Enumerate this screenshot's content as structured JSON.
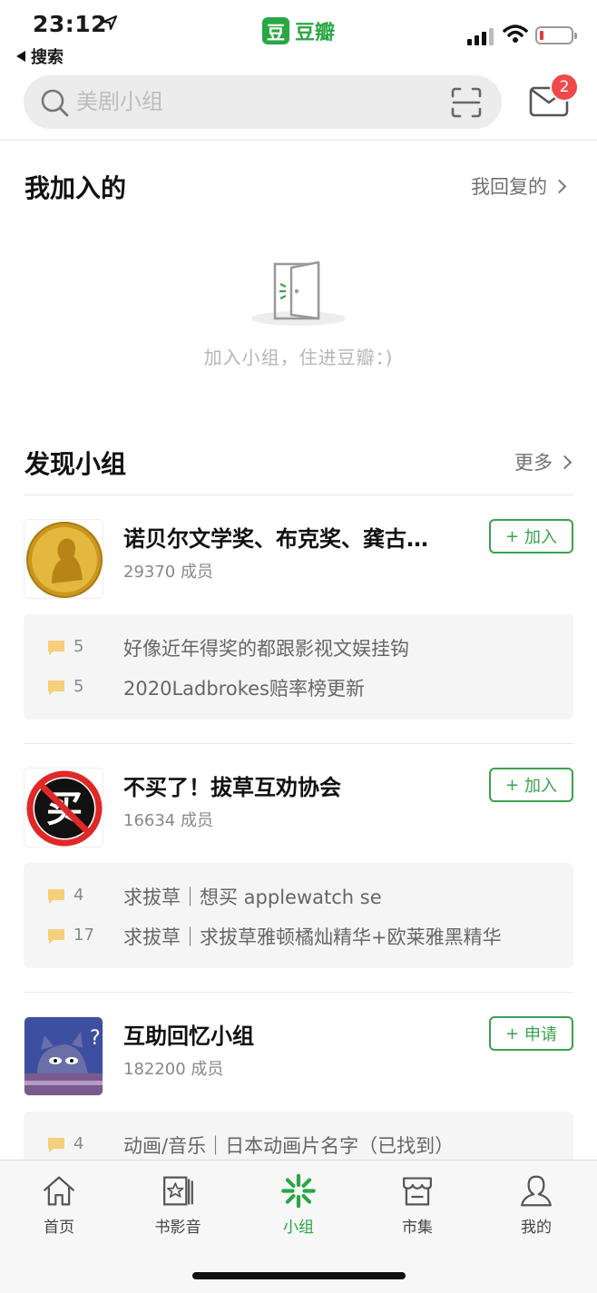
{
  "status_bar": {
    "time": "23:12",
    "back_app": "搜索",
    "brand_logo": "豆",
    "brand_name": "豆瓣"
  },
  "header": {
    "search_placeholder": "美剧小组",
    "mail_badge": "2"
  },
  "joined": {
    "title": "我加入的",
    "link": "我回复的",
    "empty_text": "加入小组，住进豆瓣：)"
  },
  "discover": {
    "title": "发现小组",
    "link": "更多",
    "groups": [
      {
        "name": "诺贝尔文学奖、布克奖、龚古…",
        "members": "29370 成员",
        "action": "加入",
        "posts": [
          {
            "count": "5",
            "title": "好像近年得奖的都跟影视文娱挂钩"
          },
          {
            "count": "5",
            "title": "2020Ladbrokes赔率榜更新"
          }
        ]
      },
      {
        "name": "不买了！拔草互劝协会",
        "members": "16634 成员",
        "action": "加入",
        "posts": [
          {
            "count": "4",
            "title": "求拔草｜想买 applewatch se"
          },
          {
            "count": "17",
            "title": "求拔草｜求拔草雅顿橘灿精华+欧莱雅黑精华"
          }
        ]
      },
      {
        "name": "互助回忆小组",
        "members": "182200 成员",
        "action": "申请",
        "posts": [
          {
            "count": "4",
            "title": "动画/音乐｜日本动画片名字（已找到）"
          }
        ]
      }
    ]
  },
  "tabbar": {
    "items": [
      {
        "label": "首页",
        "icon": "home-icon"
      },
      {
        "label": "书影音",
        "icon": "media-icon"
      },
      {
        "label": "小组",
        "icon": "group-icon"
      },
      {
        "label": "市集",
        "icon": "market-icon"
      },
      {
        "label": "我的",
        "icon": "profile-icon"
      }
    ]
  },
  "colors": {
    "accent": "#2aa745",
    "badge": "#ef4a4a",
    "post_icon": "#f5cf7a"
  }
}
